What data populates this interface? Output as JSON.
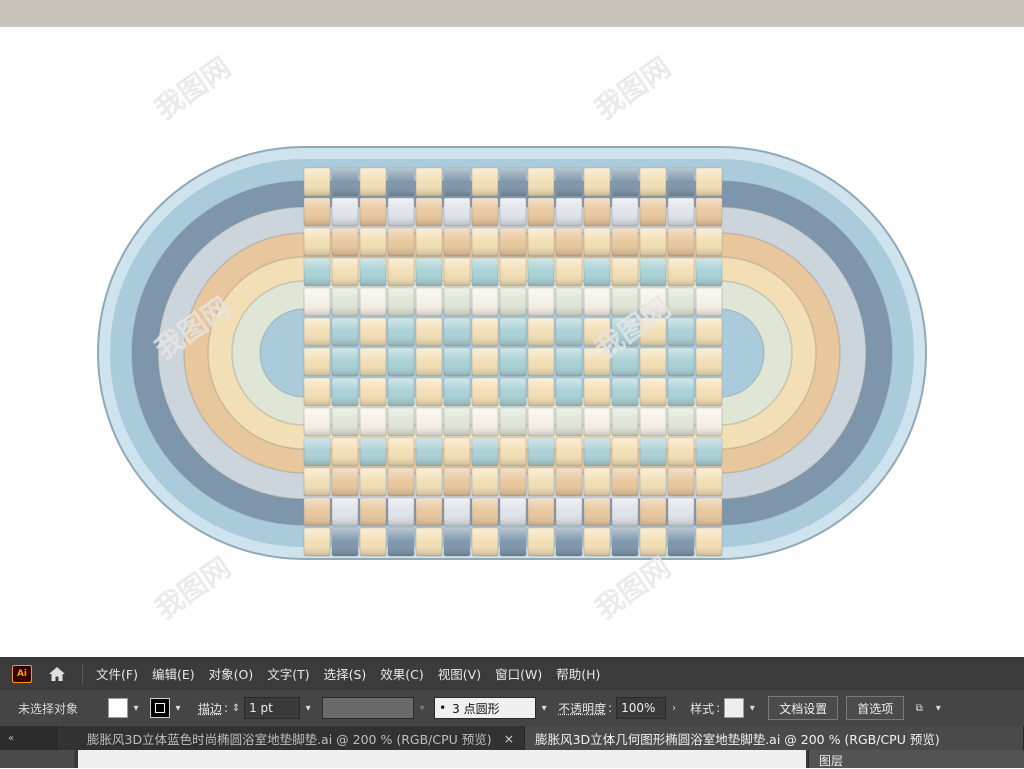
{
  "menubar": {
    "logo": "Ai",
    "items": [
      "文件(F)",
      "编辑(E)",
      "对象(O)",
      "文字(T)",
      "选择(S)",
      "效果(C)",
      "视图(V)",
      "窗口(W)",
      "帮助(H)"
    ]
  },
  "control_bar": {
    "selection_status": "未选择对象",
    "stroke_label": "描边",
    "stroke_value": "1 pt",
    "brush_value": "3 点圆形",
    "opacity_label": "不透明度",
    "opacity_value": "100%",
    "style_label": "样式",
    "doc_setup_button": "文档设置",
    "preferences_button": "首选项"
  },
  "tabs": [
    {
      "label": "膨胀风3D立体蓝色时尚椭圆浴室地垫脚垫.ai @ 200 % (RGB/CPU 预览)",
      "active": false
    },
    {
      "label": "膨胀风3D立体几何图形椭圆浴室地垫脚垫.ai @ 200 % (RGB/CPU 预览)",
      "active": true
    }
  ],
  "panel": {
    "title": "图层"
  },
  "watermark": {
    "text": "我图网"
  },
  "colors": {
    "blue": "#7e96ab",
    "light_blue": "#a9cbdc",
    "cream": "#f3dfb5",
    "tan": "#e8c79c",
    "mint": "#a9d1d6",
    "white_tile": "#f6f1e8",
    "sage": "#dfe6d6"
  },
  "icons": [
    "home-icon",
    "chevron-down-icon",
    "close-icon",
    "arrange-icon"
  ]
}
